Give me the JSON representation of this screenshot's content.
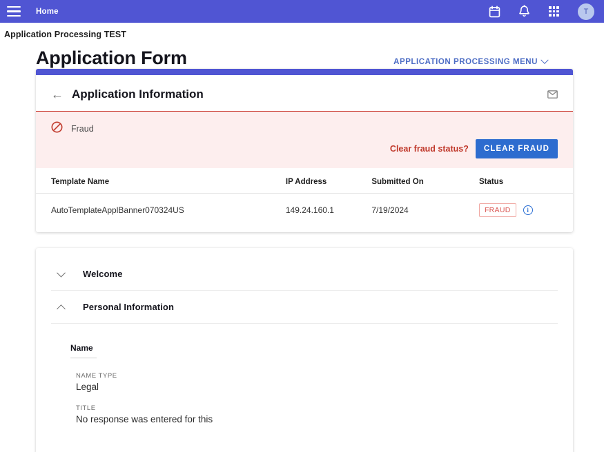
{
  "appbar": {
    "menu_icon": "hamburger-icon",
    "home_label": "Home",
    "icons": [
      "calendar-icon",
      "bell-icon",
      "apps-grid-icon"
    ],
    "avatar_initial": "T"
  },
  "breadcrumb": {
    "text": "Application Processing TEST"
  },
  "page": {
    "title": "Application Form",
    "menu_link_label": "APPLICATION PROCESSING MENU"
  },
  "info_card": {
    "back_arrow": "←",
    "title": "Application Information",
    "mail_icon": "envelope-icon",
    "alert": {
      "icon": "block-icon",
      "label": "Fraud",
      "question": "Clear fraud status?",
      "button_label": "CLEAR FRAUD"
    },
    "table": {
      "columns": [
        "Template Name",
        "IP Address",
        "Submitted On",
        "Status"
      ],
      "rows": [
        {
          "template_name": "AutoTemplateApplBanner070324US",
          "ip_address": "149.24.160.1",
          "submitted_on": "7/19/2024",
          "status": "FRAUD",
          "status_info_icon": "info-circle-icon"
        }
      ]
    }
  },
  "accordion": {
    "items": [
      {
        "label": "Welcome",
        "expanded": false,
        "chevron": "chevron-down-icon"
      },
      {
        "label": "Personal Information",
        "expanded": true,
        "chevron": "chevron-up-icon"
      }
    ]
  },
  "personal_information": {
    "group_title": "Name",
    "fields": [
      {
        "label": "NAME TYPE",
        "value": "Legal"
      },
      {
        "label": "TITLE",
        "value": "No response was entered for this"
      }
    ]
  },
  "colors": {
    "brand_purple": "#5055d3",
    "link_blue": "#4c6cc4",
    "button_blue": "#2d6ccf",
    "alert_bg": "#fdeeee",
    "alert_border": "#c9382e",
    "alert_text": "#c0392b",
    "badge_red": "#d9534f",
    "info_blue": "#2b6fd4"
  }
}
